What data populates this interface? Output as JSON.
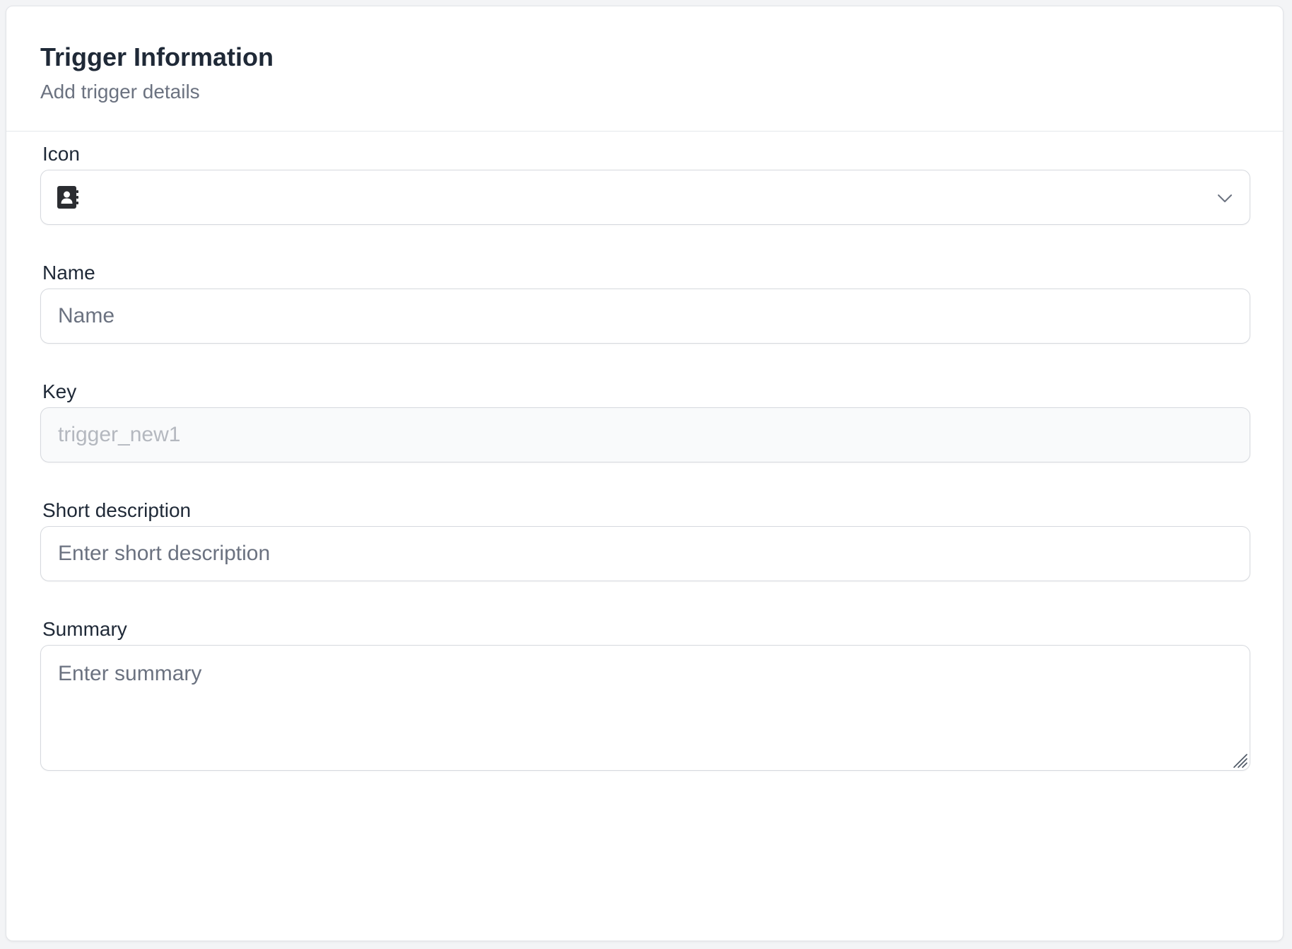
{
  "header": {
    "title": "Trigger Information",
    "subtitle": "Add trigger details"
  },
  "fields": {
    "icon": {
      "label": "Icon",
      "selected_icon": "contact-book-icon"
    },
    "name": {
      "label": "Name",
      "placeholder": "Name",
      "value": ""
    },
    "key": {
      "label": "Key",
      "placeholder": "trigger_new1",
      "value": ""
    },
    "short_description": {
      "label": "Short description",
      "placeholder": "Enter short description",
      "value": ""
    },
    "summary": {
      "label": "Summary",
      "placeholder": "Enter summary",
      "value": ""
    }
  },
  "colors": {
    "title": "#1f2937",
    "subtitle": "#6b7280",
    "border": "#d6d9de",
    "disabled_bg": "#f9fafb"
  }
}
